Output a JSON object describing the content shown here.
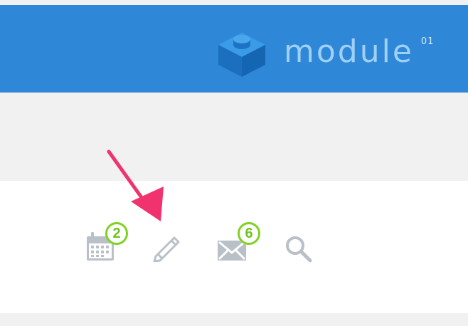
{
  "header": {
    "brand_name": "module",
    "brand_version": "01",
    "logo_icon": "cube-brick-icon",
    "background_color": "#2f87d8"
  },
  "toolbar": {
    "calendar": {
      "icon": "calendar-icon",
      "badge_count": "2"
    },
    "edit": {
      "icon": "pencil-icon"
    },
    "mail": {
      "icon": "envelope-icon",
      "badge_count": "6"
    },
    "search": {
      "icon": "search-icon"
    },
    "icon_color": "#b9c0c8",
    "badge_color": "#7ed321"
  },
  "annotation": {
    "icon": "arrow-icon",
    "color": "#f0336f"
  }
}
